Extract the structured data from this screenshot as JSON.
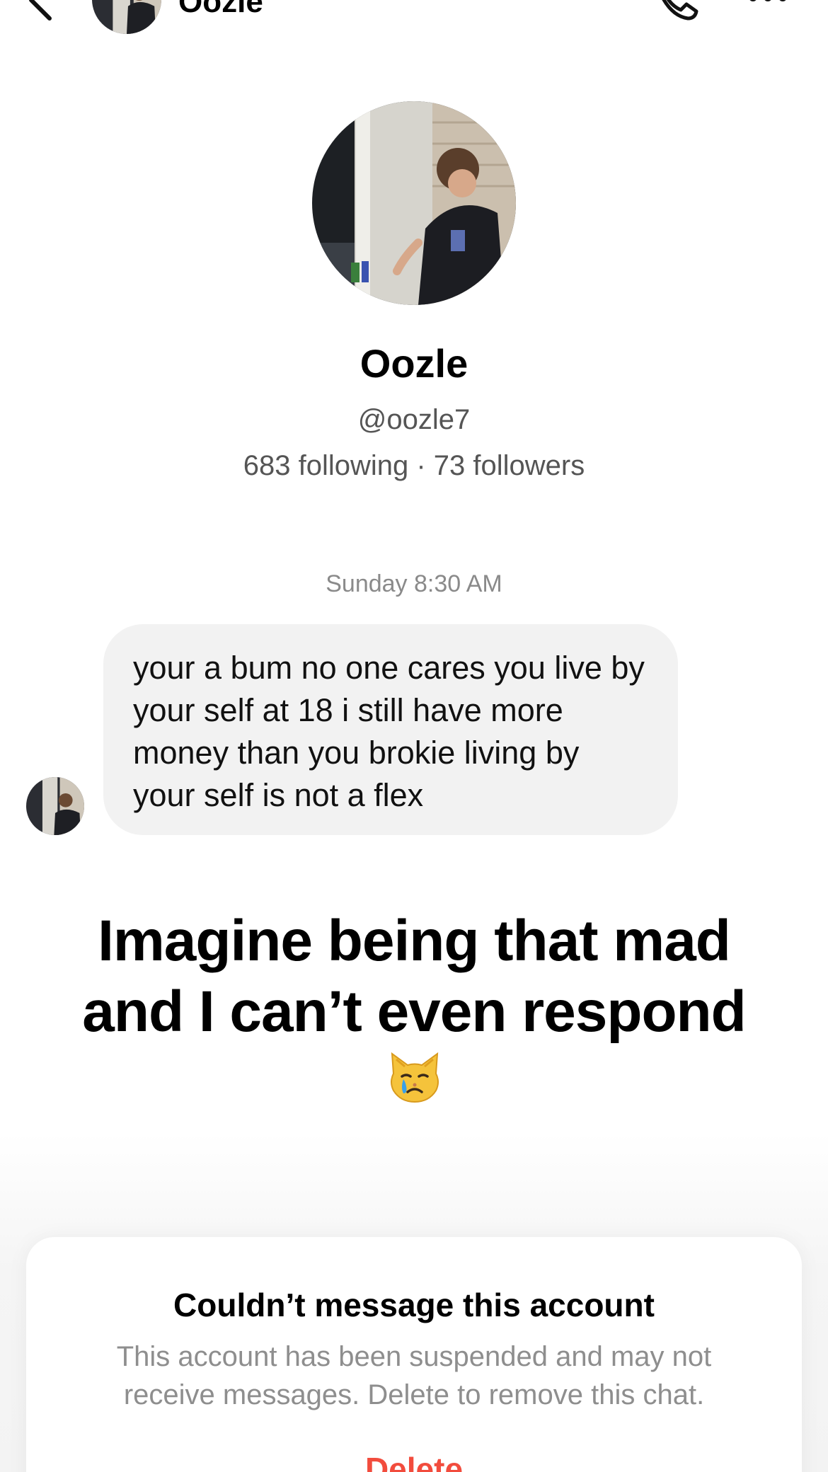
{
  "header": {
    "name": "Oozle"
  },
  "profile": {
    "name": "Oozle",
    "handle": "@oozle7",
    "stats": "683 following · 73 followers"
  },
  "chat": {
    "timestamp": "Sunday 8:30 AM",
    "message": "your a bum no one cares you live by your self at 18 i still have more money than you brokie living by your self is not a flex"
  },
  "caption": {
    "line1": "Imagine being that mad",
    "line2": "and I can’t even respond"
  },
  "caption_emoji": "crying-cat-face",
  "notice": {
    "title": "Couldn’t message this account",
    "body": "This account has been suspended and may not receive messages. Delete to remove this chat.",
    "delete_label": "Delete"
  },
  "colors": {
    "delete": "#f24c3d",
    "bubble": "#f2f2f2",
    "muted": "#8e8e8e"
  }
}
